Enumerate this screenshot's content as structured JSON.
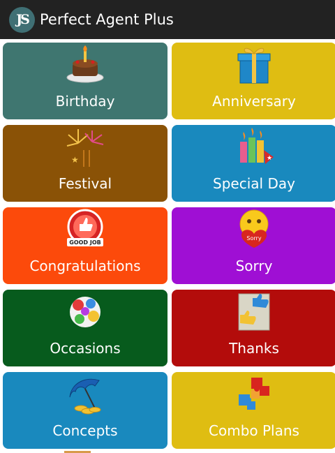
{
  "app": {
    "title": "Perfect Agent Plus",
    "logo_text": "JS"
  },
  "tiles": [
    {
      "label": "Birthday",
      "color": "#3f7670",
      "icon": "birthday-cake-icon"
    },
    {
      "label": "Anniversary",
      "color": "#dfbd12",
      "icon": "gift-box-icon"
    },
    {
      "label": "Festival",
      "color": "#8a5206",
      "icon": "fireworks-icon"
    },
    {
      "label": "Special Day",
      "color": "#1989be",
      "icon": "candles-icon"
    },
    {
      "label": "Congratulations",
      "color": "#fc4a0b",
      "icon": "good-job-badge-icon"
    },
    {
      "label": "Sorry",
      "color": "#9f0fd4",
      "icon": "sorry-smiley-icon"
    },
    {
      "label": "Occasions",
      "color": "#075b1d",
      "icon": "balloons-collage-icon"
    },
    {
      "label": "Thanks",
      "color": "#b30c0b",
      "icon": "thumbs-up-thanks-icon"
    },
    {
      "label": "Concepts",
      "color": "#1989be",
      "icon": "umbrella-coins-icon"
    },
    {
      "label": "Combo Plans",
      "color": "#dfbd12",
      "icon": "puzzle-pieces-icon"
    }
  ]
}
